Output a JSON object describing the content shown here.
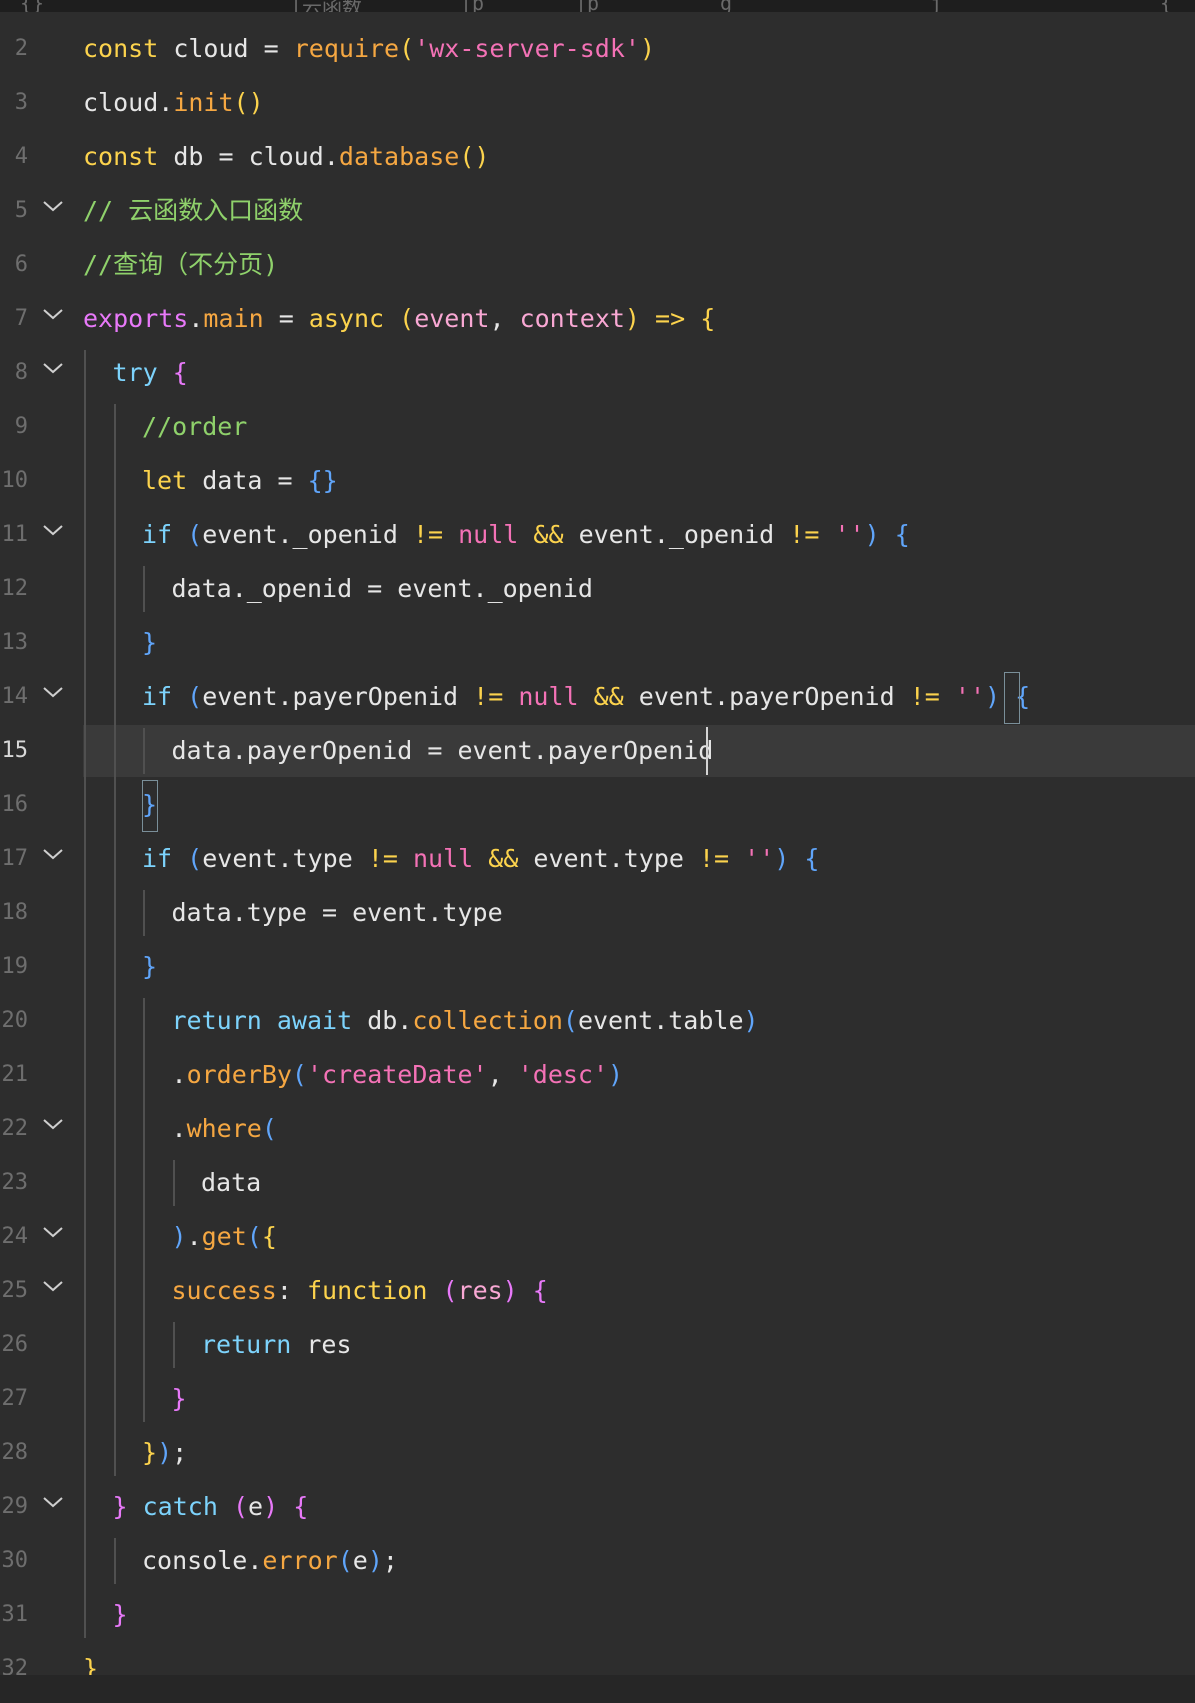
{
  "topbar_fragments": [
    "{}",
    "|云函数",
    "|p",
    "|p",
    "g",
    "j",
    "{"
  ],
  "lines": [
    {
      "n": "2",
      "indent": 0,
      "fold": false,
      "tokens": [
        [
          "kw",
          "const"
        ],
        [
          "pu",
          " cloud "
        ],
        [
          "pu",
          "="
        ],
        [
          "pu",
          " "
        ],
        [
          "fn",
          "require"
        ],
        [
          "b1",
          "("
        ],
        [
          "str",
          "'wx-server-sdk'"
        ],
        [
          "b1",
          ")"
        ]
      ]
    },
    {
      "n": "3",
      "indent": 0,
      "fold": false,
      "tokens": [
        [
          "pu",
          "cloud."
        ],
        [
          "fn",
          "init"
        ],
        [
          "b1",
          "()"
        ]
      ]
    },
    {
      "n": "4",
      "indent": 0,
      "fold": false,
      "tokens": [
        [
          "kw",
          "const"
        ],
        [
          "pu",
          " db = cloud."
        ],
        [
          "fn",
          "database"
        ],
        [
          "b1",
          "()"
        ]
      ]
    },
    {
      "n": "5",
      "indent": 0,
      "fold": true,
      "tokens": [
        [
          "com",
          "// 云函数入口函数"
        ]
      ]
    },
    {
      "n": "6",
      "indent": 0,
      "fold": false,
      "tokens": [
        [
          "com",
          "//查询（不分页)"
        ]
      ]
    },
    {
      "n": "7",
      "indent": 0,
      "fold": true,
      "tokens": [
        [
          "ex",
          "exports"
        ],
        [
          "pu",
          "."
        ],
        [
          "fn",
          "main"
        ],
        [
          "pu",
          " = "
        ],
        [
          "kw",
          "async"
        ],
        [
          "pu",
          " "
        ],
        [
          "b1",
          "("
        ],
        [
          "par",
          "event"
        ],
        [
          "pu",
          ", "
        ],
        [
          "par",
          "context"
        ],
        [
          "b1",
          ")"
        ],
        [
          "pu",
          " "
        ],
        [
          "kw",
          "=>"
        ],
        [
          "pu",
          " "
        ],
        [
          "b1",
          "{"
        ]
      ]
    },
    {
      "n": "8",
      "indent": 1,
      "fold": true,
      "tokens": [
        [
          "kw2",
          "try"
        ],
        [
          "pu",
          " "
        ],
        [
          "b2",
          "{"
        ]
      ]
    },
    {
      "n": "9",
      "indent": 2,
      "fold": false,
      "tokens": [
        [
          "com",
          "//order"
        ]
      ]
    },
    {
      "n": "10",
      "indent": 2,
      "fold": false,
      "tokens": [
        [
          "kw",
          "let"
        ],
        [
          "pu",
          " data = "
        ],
        [
          "b3",
          "{}"
        ]
      ]
    },
    {
      "n": "11",
      "indent": 2,
      "fold": true,
      "tokens": [
        [
          "kw2",
          "if"
        ],
        [
          "pu",
          " "
        ],
        [
          "b3",
          "("
        ],
        [
          "pu",
          "event._openid "
        ],
        [
          "kw",
          "!="
        ],
        [
          "pu",
          " "
        ],
        [
          "nul",
          "null"
        ],
        [
          "pu",
          " "
        ],
        [
          "kw",
          "&&"
        ],
        [
          "pu",
          " event._openid "
        ],
        [
          "kw",
          "!="
        ],
        [
          "pu",
          " "
        ],
        [
          "str",
          "''"
        ],
        [
          "b3",
          ")"
        ],
        [
          "pu",
          " "
        ],
        [
          "b3",
          "{"
        ]
      ]
    },
    {
      "n": "12",
      "indent": 3,
      "fold": false,
      "tokens": [
        [
          "pu",
          "data._openid = event._openid"
        ]
      ]
    },
    {
      "n": "13",
      "indent": 2,
      "fold": false,
      "tokens": [
        [
          "b3",
          "}"
        ]
      ]
    },
    {
      "n": "14",
      "indent": 2,
      "fold": true,
      "tokens": [
        [
          "kw2",
          "if"
        ],
        [
          "pu",
          " "
        ],
        [
          "b3",
          "("
        ],
        [
          "pu",
          "event.payerOpenid "
        ],
        [
          "kw",
          "!="
        ],
        [
          "pu",
          " "
        ],
        [
          "nul",
          "null"
        ],
        [
          "pu",
          " "
        ],
        [
          "kw",
          "&&"
        ],
        [
          "pu",
          " event.payerOpenid "
        ],
        [
          "kw",
          "!="
        ],
        [
          "pu",
          " "
        ],
        [
          "str",
          "''"
        ],
        [
          "b3",
          ")"
        ],
        [
          "pu",
          " "
        ],
        [
          "b3",
          "{"
        ]
      ]
    },
    {
      "n": "15",
      "indent": 3,
      "fold": false,
      "current": true,
      "tokens": [
        [
          "pu",
          "data.payerOpenid = event.payerOpenid"
        ]
      ]
    },
    {
      "n": "16",
      "indent": 2,
      "fold": false,
      "tokens": [
        [
          "b3",
          "}"
        ]
      ]
    },
    {
      "n": "17",
      "indent": 2,
      "fold": true,
      "tokens": [
        [
          "kw2",
          "if"
        ],
        [
          "pu",
          " "
        ],
        [
          "b3",
          "("
        ],
        [
          "pu",
          "event.type "
        ],
        [
          "kw",
          "!="
        ],
        [
          "pu",
          " "
        ],
        [
          "nul",
          "null"
        ],
        [
          "pu",
          " "
        ],
        [
          "kw",
          "&&"
        ],
        [
          "pu",
          " event.type "
        ],
        [
          "kw",
          "!="
        ],
        [
          "pu",
          " "
        ],
        [
          "str",
          "''"
        ],
        [
          "b3",
          ")"
        ],
        [
          "pu",
          " "
        ],
        [
          "b3",
          "{"
        ]
      ]
    },
    {
      "n": "18",
      "indent": 3,
      "fold": false,
      "tokens": [
        [
          "pu",
          "data.type = event.type"
        ]
      ]
    },
    {
      "n": "19",
      "indent": 2,
      "fold": false,
      "tokens": [
        [
          "b3",
          "}"
        ]
      ]
    },
    {
      "n": "20",
      "indent": 3,
      "fold": false,
      "tokens": [
        [
          "kw2",
          "return"
        ],
        [
          "pu",
          " "
        ],
        [
          "kw2",
          "await"
        ],
        [
          "pu",
          " db."
        ],
        [
          "fn",
          "collection"
        ],
        [
          "b3",
          "("
        ],
        [
          "pu",
          "event.table"
        ],
        [
          "b3",
          ")"
        ]
      ]
    },
    {
      "n": "21",
      "indent": 3,
      "fold": false,
      "tokens": [
        [
          "pu",
          "."
        ],
        [
          "fn",
          "orderBy"
        ],
        [
          "b3",
          "("
        ],
        [
          "str",
          "'createDate'"
        ],
        [
          "pu",
          ", "
        ],
        [
          "str",
          "'desc'"
        ],
        [
          "b3",
          ")"
        ]
      ]
    },
    {
      "n": "22",
      "indent": 3,
      "fold": true,
      "tokens": [
        [
          "pu",
          "."
        ],
        [
          "fn",
          "where"
        ],
        [
          "b3",
          "("
        ]
      ]
    },
    {
      "n": "23",
      "indent": 4,
      "fold": false,
      "tokens": [
        [
          "pu",
          "data"
        ]
      ]
    },
    {
      "n": "24",
      "indent": 3,
      "fold": true,
      "tokens": [
        [
          "b3",
          ")"
        ],
        [
          "pu",
          "."
        ],
        [
          "fn",
          "get"
        ],
        [
          "b3",
          "("
        ],
        [
          "b1",
          "{"
        ]
      ]
    },
    {
      "n": "25",
      "indent": 3,
      "fold": true,
      "tokens": [
        [
          "fn",
          "success"
        ],
        [
          "pu",
          ": "
        ],
        [
          "kw",
          "function"
        ],
        [
          "pu",
          " "
        ],
        [
          "b2",
          "("
        ],
        [
          "par",
          "res"
        ],
        [
          "b2",
          ")"
        ],
        [
          "pu",
          " "
        ],
        [
          "b2",
          "{"
        ]
      ]
    },
    {
      "n": "26",
      "indent": 4,
      "fold": false,
      "tokens": [
        [
          "kw2",
          "return"
        ],
        [
          "pu",
          " res"
        ]
      ]
    },
    {
      "n": "27",
      "indent": 3,
      "fold": false,
      "tokens": [
        [
          "b2",
          "}"
        ]
      ]
    },
    {
      "n": "28",
      "indent": 2,
      "fold": false,
      "tokens": [
        [
          "b1",
          "}"
        ],
        [
          "b3",
          ")"
        ],
        [
          "pu",
          ";"
        ]
      ]
    },
    {
      "n": "29",
      "indent": 1,
      "fold": true,
      "tokens": [
        [
          "b2",
          "}"
        ],
        [
          "pu",
          " "
        ],
        [
          "kw2",
          "catch"
        ],
        [
          "pu",
          " "
        ],
        [
          "b2",
          "("
        ],
        [
          "pu",
          "e"
        ],
        [
          "b2",
          ")"
        ],
        [
          "pu",
          " "
        ],
        [
          "b2",
          "{"
        ]
      ]
    },
    {
      "n": "30",
      "indent": 2,
      "fold": false,
      "tokens": [
        [
          "pu",
          "console."
        ],
        [
          "fn",
          "error"
        ],
        [
          "b3",
          "("
        ],
        [
          "pu",
          "e"
        ],
        [
          "b3",
          ")"
        ],
        [
          "pu",
          ";"
        ]
      ]
    },
    {
      "n": "31",
      "indent": 1,
      "fold": false,
      "tokens": [
        [
          "b2",
          "}"
        ]
      ]
    },
    {
      "n": "32",
      "indent": 0,
      "fold": false,
      "tokens": [
        [
          "b1",
          "}"
        ]
      ]
    }
  ]
}
